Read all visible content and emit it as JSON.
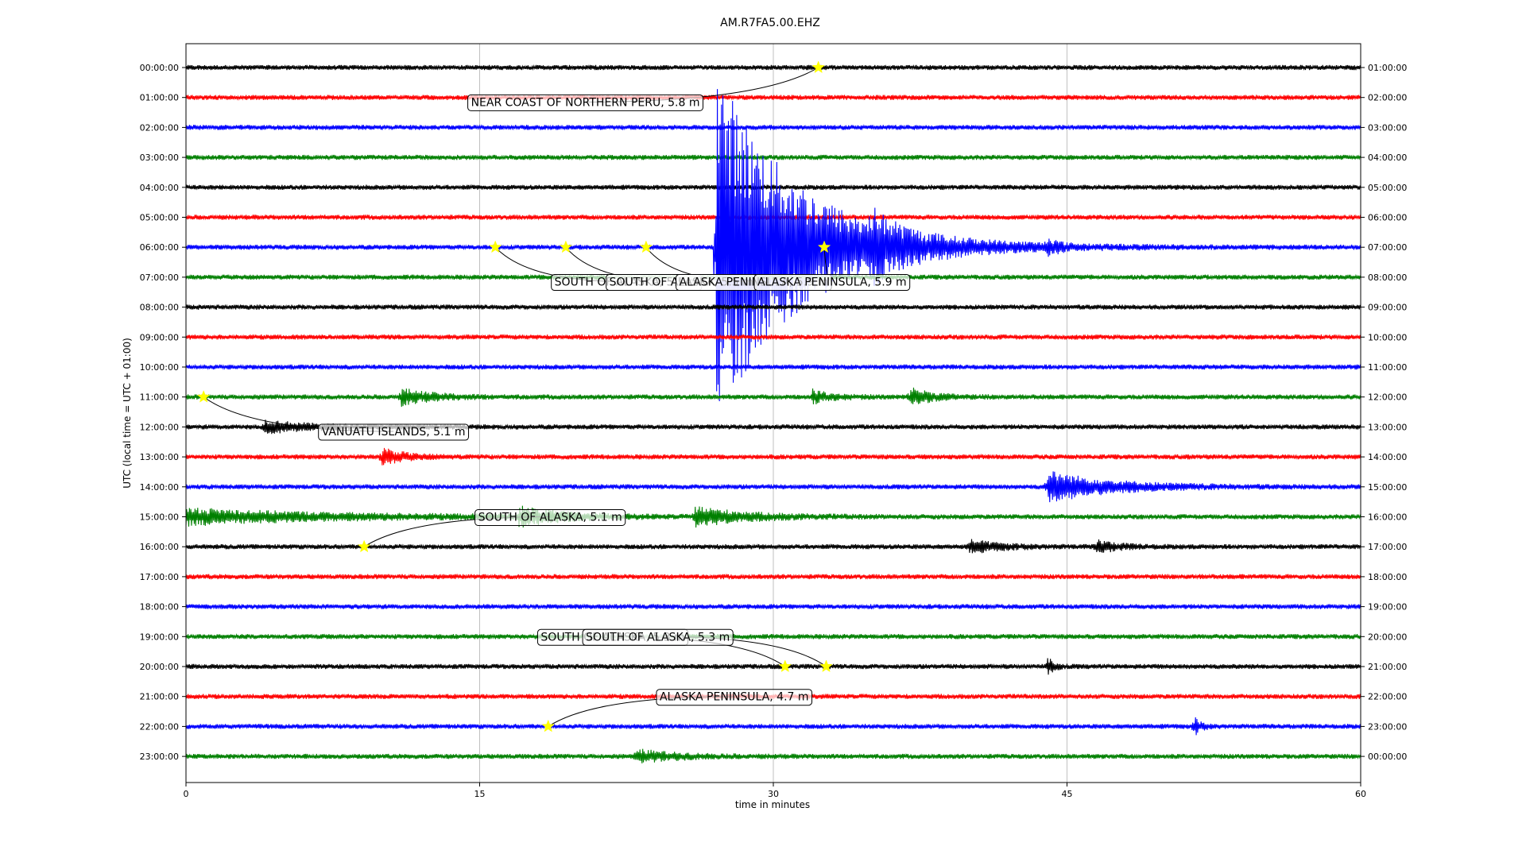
{
  "chart_data": {
    "type": "line",
    "title": "AM.R7FA5.00.EHZ",
    "xlabel": "time in minutes",
    "ylabel": "UTC (local time = UTC + 01:00)",
    "xlim": [
      0,
      60
    ],
    "x_ticks": [
      "0",
      "15",
      "30",
      "45",
      "60"
    ],
    "grid": "vertical lines at 15-minute ticks",
    "trace_colors": [
      "#000000",
      "#ff0000",
      "#0000ff",
      "#008000"
    ],
    "rows": [
      {
        "left": "00:00:00",
        "right": "01:00:00"
      },
      {
        "left": "01:00:00",
        "right": "02:00:00"
      },
      {
        "left": "02:00:00",
        "right": "03:00:00"
      },
      {
        "left": "03:00:00",
        "right": "04:00:00"
      },
      {
        "left": "04:00:00",
        "right": "05:00:00"
      },
      {
        "left": "05:00:00",
        "right": "06:00:00"
      },
      {
        "left": "06:00:00",
        "right": "07:00:00"
      },
      {
        "left": "07:00:00",
        "right": "08:00:00"
      },
      {
        "left": "08:00:00",
        "right": "09:00:00"
      },
      {
        "left": "09:00:00",
        "right": "10:00:00"
      },
      {
        "left": "10:00:00",
        "right": "11:00:00"
      },
      {
        "left": "11:00:00",
        "right": "12:00:00"
      },
      {
        "left": "12:00:00",
        "right": "13:00:00"
      },
      {
        "left": "13:00:00",
        "right": "14:00:00"
      },
      {
        "left": "14:00:00",
        "right": "15:00:00"
      },
      {
        "left": "15:00:00",
        "right": "16:00:00"
      },
      {
        "left": "16:00:00",
        "right": "17:00:00"
      },
      {
        "left": "17:00:00",
        "right": "18:00:00"
      },
      {
        "left": "18:00:00",
        "right": "19:00:00"
      },
      {
        "left": "19:00:00",
        "right": "20:00:00"
      },
      {
        "left": "20:00:00",
        "right": "21:00:00"
      },
      {
        "left": "21:00:00",
        "right": "22:00:00"
      },
      {
        "left": "22:00:00",
        "right": "23:00:00"
      },
      {
        "left": "23:00:00",
        "right": "00:00:00"
      }
    ],
    "events": [
      {
        "row": 0,
        "minute": 32.3,
        "label": "NEAR COAST OF NORTHERN PERU, 5.8 m",
        "label_minute": 20.4,
        "label_row": 1.15
      },
      {
        "row": 6,
        "minute": 15.8,
        "label": "SOUTH OF ALASKA, 5.5 m",
        "label_minute": 22.5,
        "label_row": 7.15
      },
      {
        "row": 6,
        "minute": 19.4,
        "label": "SOUTH OF ALASKA, 5.5 m",
        "label_minute": 25.3,
        "label_row": 7.15
      },
      {
        "row": 6,
        "minute": 23.5,
        "label": "ALASKA PENINSULA, 5.9 m",
        "label_minute": 29.0,
        "label_row": 7.15
      },
      {
        "row": 6,
        "minute": 32.6,
        "label": "ALASKA PENINSULA, 5.9 m",
        "label_minute": 33.0,
        "label_row": 7.15
      },
      {
        "row": 11,
        "minute": 0.9,
        "label": "VANUATU ISLANDS, 5.1 m",
        "label_minute": 10.6,
        "label_row": 12.15
      },
      {
        "row": 16,
        "minute": 9.1,
        "label": "SOUTH OF ALASKA, 5.1 m",
        "label_minute": 18.6,
        "label_row": 15.0
      },
      {
        "row": 20,
        "minute": 30.6,
        "label": "SOUTH OF ALASKA, 5.3 m",
        "label_minute": 21.8,
        "label_row": 19.0
      },
      {
        "row": 20,
        "minute": 32.7,
        "label": "SOUTH OF ALASKA, 5.3 m",
        "label_minute": 24.1,
        "label_row": 19.0
      },
      {
        "row": 22,
        "minute": 18.5,
        "label": "ALASKA PENINSULA, 4.7 m",
        "label_minute": 28.0,
        "label_row": 21.0
      }
    ],
    "bursts": [
      {
        "row": 6,
        "minute": 27.1,
        "peak_rows": 6.0,
        "decay_minutes": 4.0
      },
      {
        "row": 6,
        "minute": 34.9,
        "peak_rows": 0.6,
        "decay_minutes": 1.2
      },
      {
        "row": 6,
        "minute": 44.0,
        "peak_rows": 0.3,
        "decay_minutes": 0.4
      },
      {
        "row": 11,
        "minute": 11.0,
        "peak_rows": 0.25,
        "decay_minutes": 1.5
      },
      {
        "row": 11,
        "minute": 32.0,
        "peak_rows": 0.2,
        "decay_minutes": 1.0
      },
      {
        "row": 11,
        "minute": 37.0,
        "peak_rows": 0.3,
        "decay_minutes": 1.0
      },
      {
        "row": 12,
        "minute": 4.0,
        "peak_rows": 0.2,
        "decay_minutes": 2.0
      },
      {
        "row": 13,
        "minute": 10.0,
        "peak_rows": 0.3,
        "decay_minutes": 1.0
      },
      {
        "row": 14,
        "minute": 44.0,
        "peak_rows": 0.5,
        "decay_minutes": 3.0
      },
      {
        "row": 15,
        "minute": 0.0,
        "peak_rows": 0.25,
        "decay_minutes": 7.0
      },
      {
        "row": 15,
        "minute": 17.0,
        "peak_rows": 0.3,
        "decay_minutes": 2.0
      },
      {
        "row": 15,
        "minute": 26.0,
        "peak_rows": 0.3,
        "decay_minutes": 2.5
      },
      {
        "row": 16,
        "minute": 40.0,
        "peak_rows": 0.2,
        "decay_minutes": 1.5
      },
      {
        "row": 16,
        "minute": 46.5,
        "peak_rows": 0.2,
        "decay_minutes": 1.0
      },
      {
        "row": 20,
        "minute": 44.0,
        "peak_rows": 0.3,
        "decay_minutes": 0.3
      },
      {
        "row": 22,
        "minute": 51.5,
        "peak_rows": 0.3,
        "decay_minutes": 0.3
      },
      {
        "row": 23,
        "minute": 23.0,
        "peak_rows": 0.2,
        "decay_minutes": 2.0
      }
    ]
  }
}
